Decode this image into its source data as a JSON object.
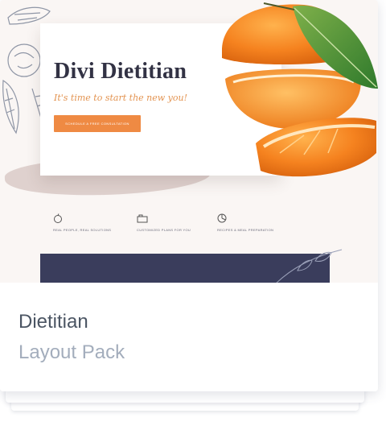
{
  "preview": {
    "hero": {
      "title": "Divi Dietitian",
      "tagline": "It's time to start the new you!",
      "button_label": "SCHEDULE A FREE CONSULTATION"
    },
    "features": [
      {
        "icon": "apple-icon",
        "label": "REAL PEOPLE, REAL SOLUTIONS"
      },
      {
        "icon": "clipboard-icon",
        "label": "CUSTOMIZED PLANS FOR YOU"
      },
      {
        "icon": "pie-chart-icon",
        "label": "RECIPES & MEAL PREPARATION"
      }
    ],
    "colors": {
      "accent": "#ef8a43",
      "dark_band": "#3a3d5c",
      "title": "#323244"
    }
  },
  "card": {
    "name": "Dietitian",
    "subtitle": "Layout Pack"
  }
}
